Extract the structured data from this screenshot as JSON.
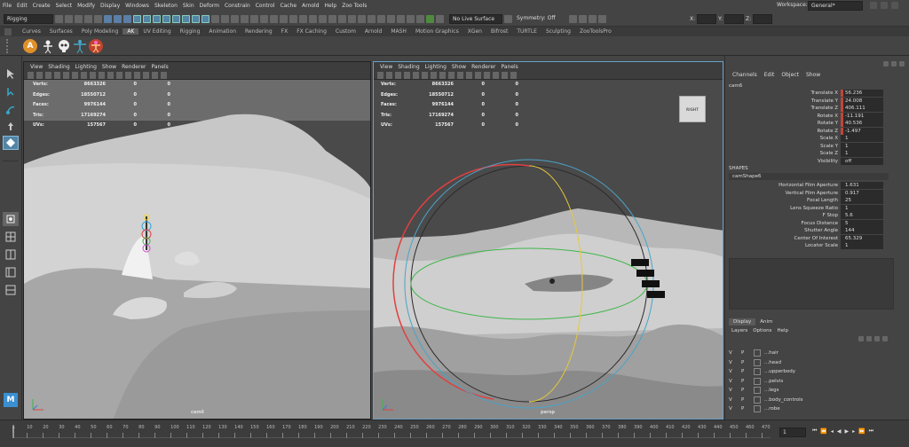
{
  "menu": [
    "File",
    "Edit",
    "Create",
    "Select",
    "Modify",
    "Display",
    "Windows",
    "Skeleton",
    "Skin",
    "Deform",
    "Constrain",
    "Control",
    "Cache",
    "Arnold",
    "Help",
    "Zoo Tools"
  ],
  "workspace": {
    "label": "Workspace:",
    "value": "General*"
  },
  "status": {
    "mode": "Rigging",
    "live_surface": "No Live Surface",
    "symmetry": "Symmetry: Off",
    "x_label": "X:",
    "y_label": "Y:",
    "z_label": "Z:"
  },
  "shelf_tabs": [
    "Curves",
    "Surfaces",
    "Poly Modeling",
    "AK",
    "UV Editing",
    "Rigging",
    "Animation",
    "Rendering",
    "FX",
    "FX Caching",
    "Custom",
    "Arnold",
    "MASH",
    "Motion Graphics",
    "XGen",
    "Bifrost",
    "TURTLE",
    "Sculpting",
    "ZooToolsPro"
  ],
  "shelf_active": "AK",
  "viewport_menu": [
    "View",
    "Shading",
    "Lighting",
    "Show",
    "Renderer",
    "Panels"
  ],
  "hud": {
    "labels": [
      "Verts:",
      "Edges:",
      "Faces:",
      "Tris:",
      "UVs:"
    ],
    "values": [
      "8663326",
      "18550712",
      "9976144",
      "17169274",
      "157567"
    ],
    "zeros": [
      "0",
      "0",
      "0",
      "0",
      "0"
    ]
  },
  "left_viewport": {
    "camera": "cam6"
  },
  "right_viewport": {
    "camera": "persp",
    "cube_label": "RIGHT"
  },
  "channel_box": {
    "tabs": [
      "Channels",
      "Edit",
      "Object",
      "Show"
    ],
    "object": "cam6",
    "attrs": [
      {
        "name": "Translate X",
        "value": "56.236",
        "key": true
      },
      {
        "name": "Translate Y",
        "value": "24.008",
        "key": true
      },
      {
        "name": "Translate Z",
        "value": "406.111",
        "key": true
      },
      {
        "name": "Rotate X",
        "value": "-11.191",
        "key": true
      },
      {
        "name": "Rotate Y",
        "value": "40.536",
        "key": true
      },
      {
        "name": "Rotate Z",
        "value": "-1.497",
        "key": true
      },
      {
        "name": "Scale X",
        "value": "1",
        "key": false
      },
      {
        "name": "Scale Y",
        "value": "1",
        "key": false
      },
      {
        "name": "Scale Z",
        "value": "1",
        "key": false
      },
      {
        "name": "Visibility",
        "value": "off",
        "key": false
      }
    ],
    "shapes_title": "SHAPES",
    "shape_name": "camShape6",
    "shape_attrs": [
      {
        "name": "Horizontal Film Aperture",
        "value": "1.631"
      },
      {
        "name": "Vertical Film Aperture",
        "value": "0.917"
      },
      {
        "name": "Focal Length",
        "value": "25"
      },
      {
        "name": "Lens Squeeze Ratio",
        "value": "1"
      },
      {
        "name": "F Stop",
        "value": "5.6"
      },
      {
        "name": "Focus Distance",
        "value": "5"
      },
      {
        "name": "Shutter Angle",
        "value": "144"
      },
      {
        "name": "Center Of Interest",
        "value": "65.329"
      },
      {
        "name": "Locator Scale",
        "value": "1"
      }
    ]
  },
  "layer_editor": {
    "tabs": [
      "Display",
      "Anim"
    ],
    "menu": [
      "Layers",
      "Options",
      "Help"
    ],
    "layers": [
      {
        "v": "V",
        "p": "P",
        "name": "...hair"
      },
      {
        "v": "V",
        "p": "P",
        "name": "...head"
      },
      {
        "v": "V",
        "p": "P",
        "name": "...upperbody"
      },
      {
        "v": "V",
        "p": "P",
        "name": "...pelvis"
      },
      {
        "v": "V",
        "p": "P",
        "name": "...legs"
      },
      {
        "v": "V",
        "p": "P",
        "name": "...body_controls"
      },
      {
        "v": "V",
        "p": "P",
        "name": "...robe"
      }
    ]
  },
  "timeline": {
    "ticks": [
      "1",
      "10",
      "20",
      "30",
      "40",
      "50",
      "60",
      "70",
      "80",
      "90",
      "100",
      "110",
      "120",
      "130",
      "140",
      "150",
      "160",
      "170",
      "180",
      "190",
      "200",
      "210",
      "220",
      "230",
      "240",
      "250",
      "260",
      "270",
      "280",
      "290",
      "300",
      "310",
      "320",
      "330",
      "340",
      "350",
      "360",
      "370",
      "380",
      "390",
      "400",
      "410",
      "420",
      "430",
      "440",
      "450",
      "460",
      "470"
    ],
    "current_frame": "1"
  },
  "colors": {
    "accent": "#5285a6",
    "key": "#c3443a"
  }
}
